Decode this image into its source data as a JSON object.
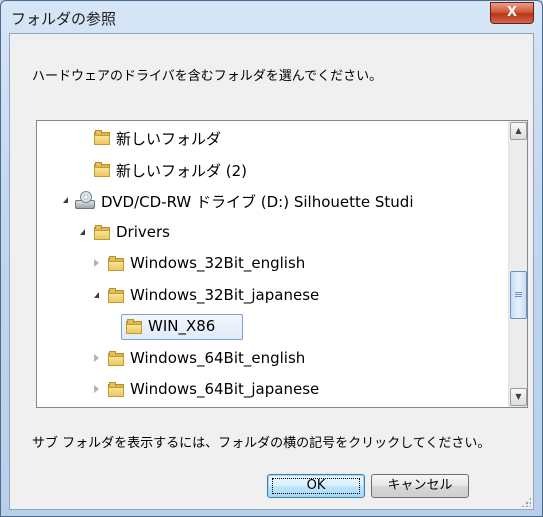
{
  "window": {
    "title": "フォルダの参照",
    "close_label": "X"
  },
  "instruction": "ハードウェアのドライバを含むフォルダを選んでください。",
  "tree": [
    {
      "label": "新しいフォルダ",
      "type": "folder",
      "level": 2,
      "expander": "none"
    },
    {
      "label": "新しいフォルダ (2)",
      "type": "folder",
      "level": 2,
      "expander": "none"
    },
    {
      "label": "DVD/CD-RW ドライブ (D:) Silhouette Studi",
      "type": "drive",
      "level": 1,
      "expander": "expanded"
    },
    {
      "label": "Drivers",
      "type": "folder",
      "level": 2,
      "expander": "expanded"
    },
    {
      "label": "Windows_32Bit_english",
      "type": "folder",
      "level": 3,
      "expander": "collapsed"
    },
    {
      "label": "Windows_32Bit_japanese",
      "type": "folder",
      "level": 3,
      "expander": "expanded"
    },
    {
      "label": "WIN_X86",
      "type": "folder",
      "level": 4,
      "expander": "none",
      "selected": true
    },
    {
      "label": "Windows_64Bit_english",
      "type": "folder",
      "level": 3,
      "expander": "collapsed"
    },
    {
      "label": "Windows_64Bit_japanese",
      "type": "folder",
      "level": 3,
      "expander": "collapsed"
    }
  ],
  "hint": "サブ フォルダを表示するには、フォルダの横の記号をクリックしてください。",
  "buttons": {
    "ok": "OK",
    "cancel": "キャンセル"
  },
  "colors": {
    "selection_border": "#7da2ce",
    "close_button": "#c8462a"
  }
}
